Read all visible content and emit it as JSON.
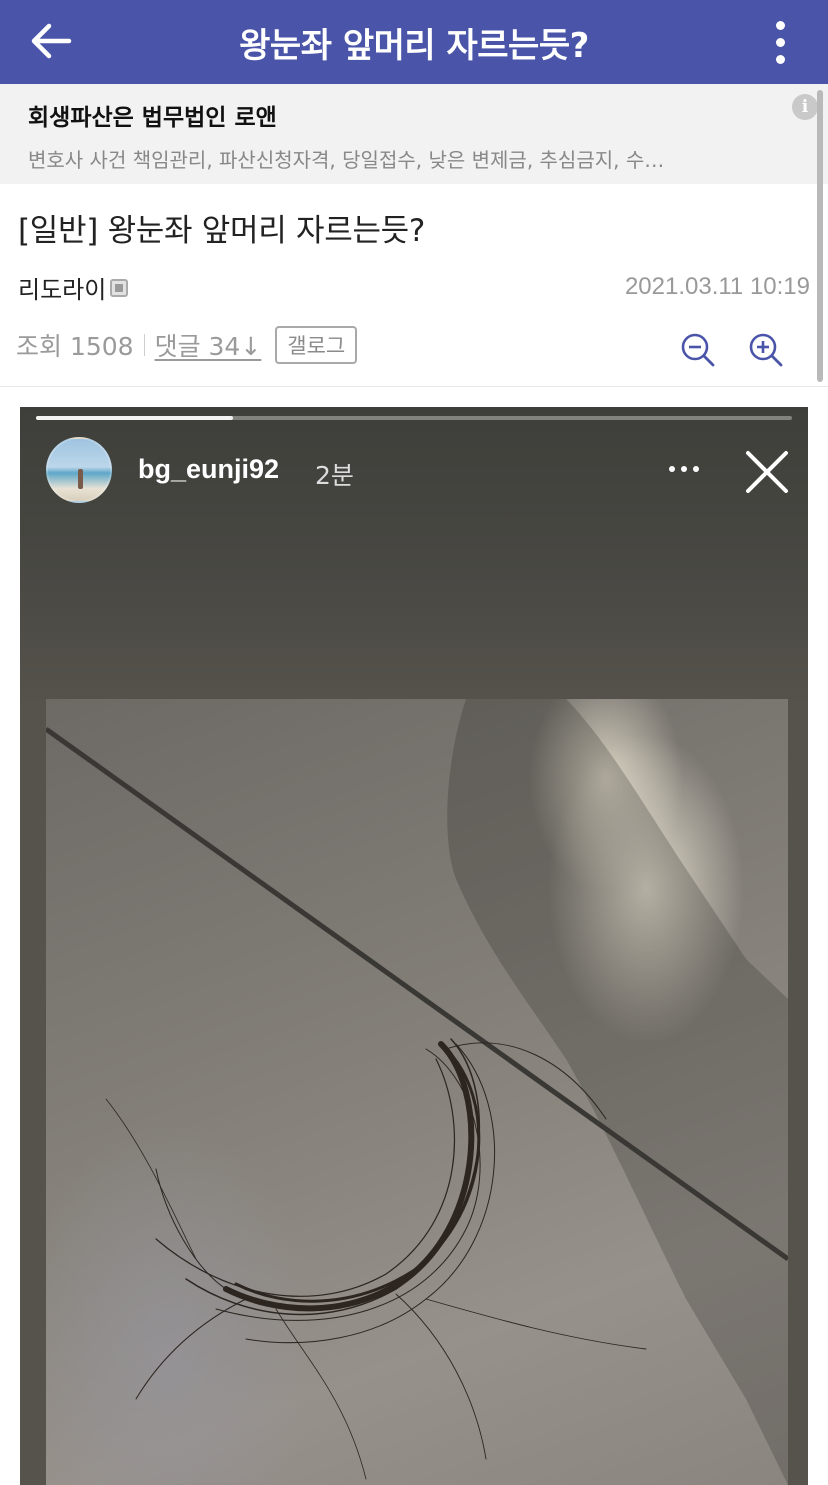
{
  "appbar": {
    "title": "왕눈좌 앞머리 자르는듯?",
    "back_icon": "arrow-left-icon",
    "more_icon": "more-vertical-icon",
    "background": "#4a55aa"
  },
  "ad": {
    "title": "회생파산은 법무법인 로앤",
    "description": "변호사 사건 책임관리, 파산신청자격, 당일접수, 낮은 변제금, 추심금지, 수…",
    "info_label": "i"
  },
  "post": {
    "title": "[일반] 왕눈좌 앞머리 자르는듯?",
    "author": "리도라이",
    "date": "2021.03.11 10:19",
    "views": "조회 1508",
    "comments": "댓글 34↓",
    "gallog": "갤로그"
  },
  "story": {
    "username": "bg_eunji92",
    "time": "2분",
    "progress": 0.26
  }
}
